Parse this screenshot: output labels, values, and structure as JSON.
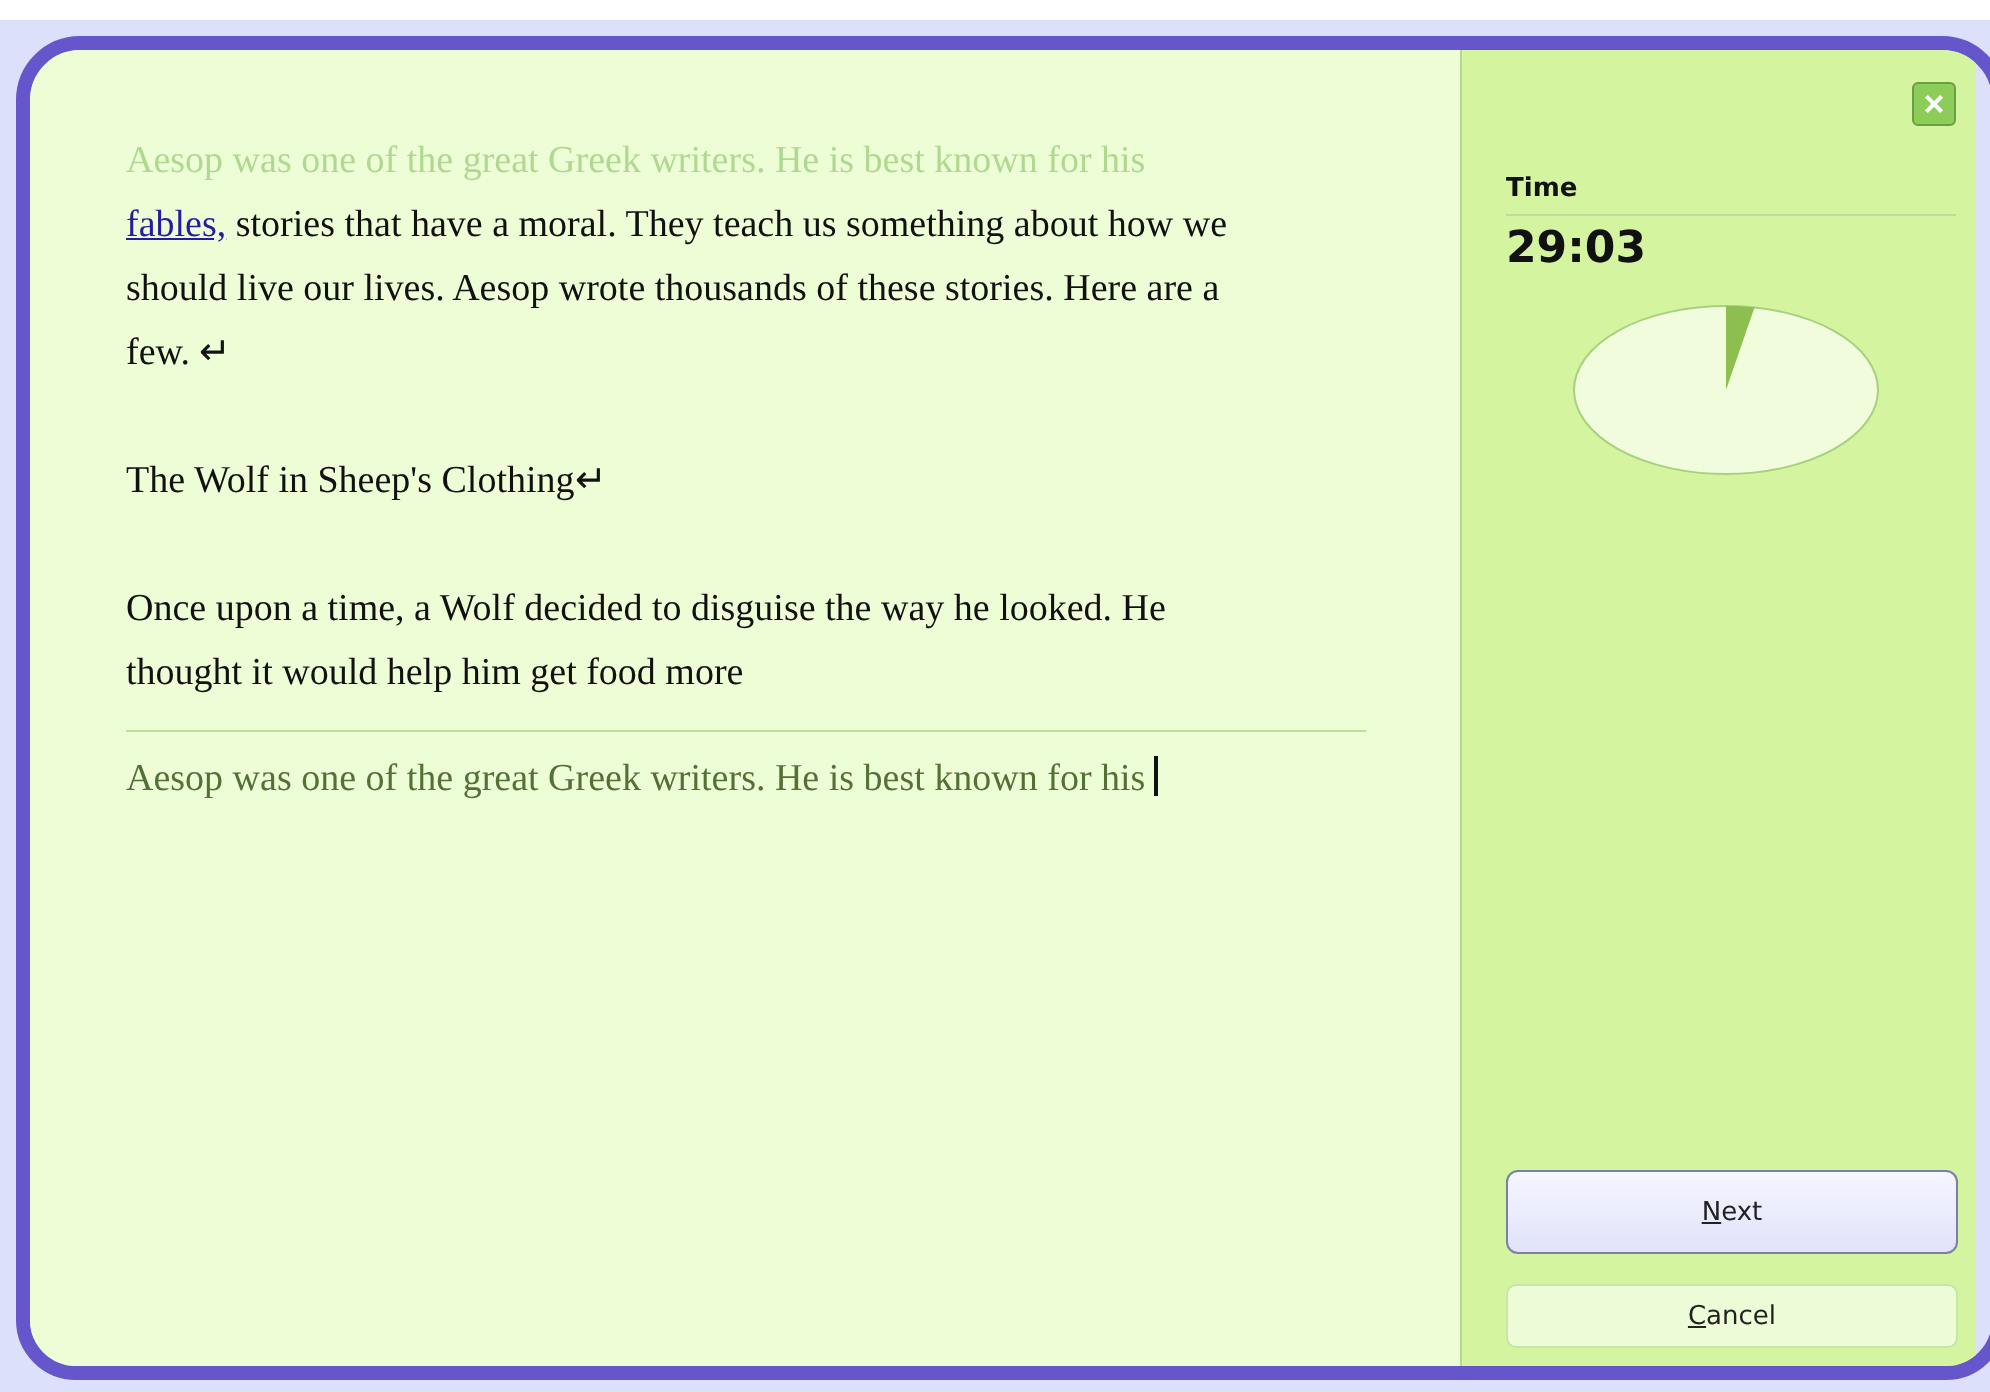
{
  "passage": {
    "paragraphs": [
      {
        "typed": "Aesop was one of the great Greek writers. He is best known for his ",
        "link": "fables,",
        "text": " stories that have a moral. They teach us something about how we should live our lives. Aesop wrote thousands of these stories. Here are a few. ↵"
      },
      {
        "text": "The Wolf in Sheep's Clothing↵"
      },
      {
        "text": "Once upon a time, a Wolf decided to disguise the way he looked. He thought it would help him get food more"
      }
    ]
  },
  "answer": {
    "value": "Aesop was one of the great Greek writers. He is best known for his "
  },
  "close_button": {
    "label": "×"
  },
  "timer": {
    "label": "Time",
    "value": "29:03"
  },
  "buttons": [
    {
      "label": "Next",
      "kind": "primary"
    },
    {
      "label": "Cancel",
      "kind": "secondary"
    }
  ]
}
